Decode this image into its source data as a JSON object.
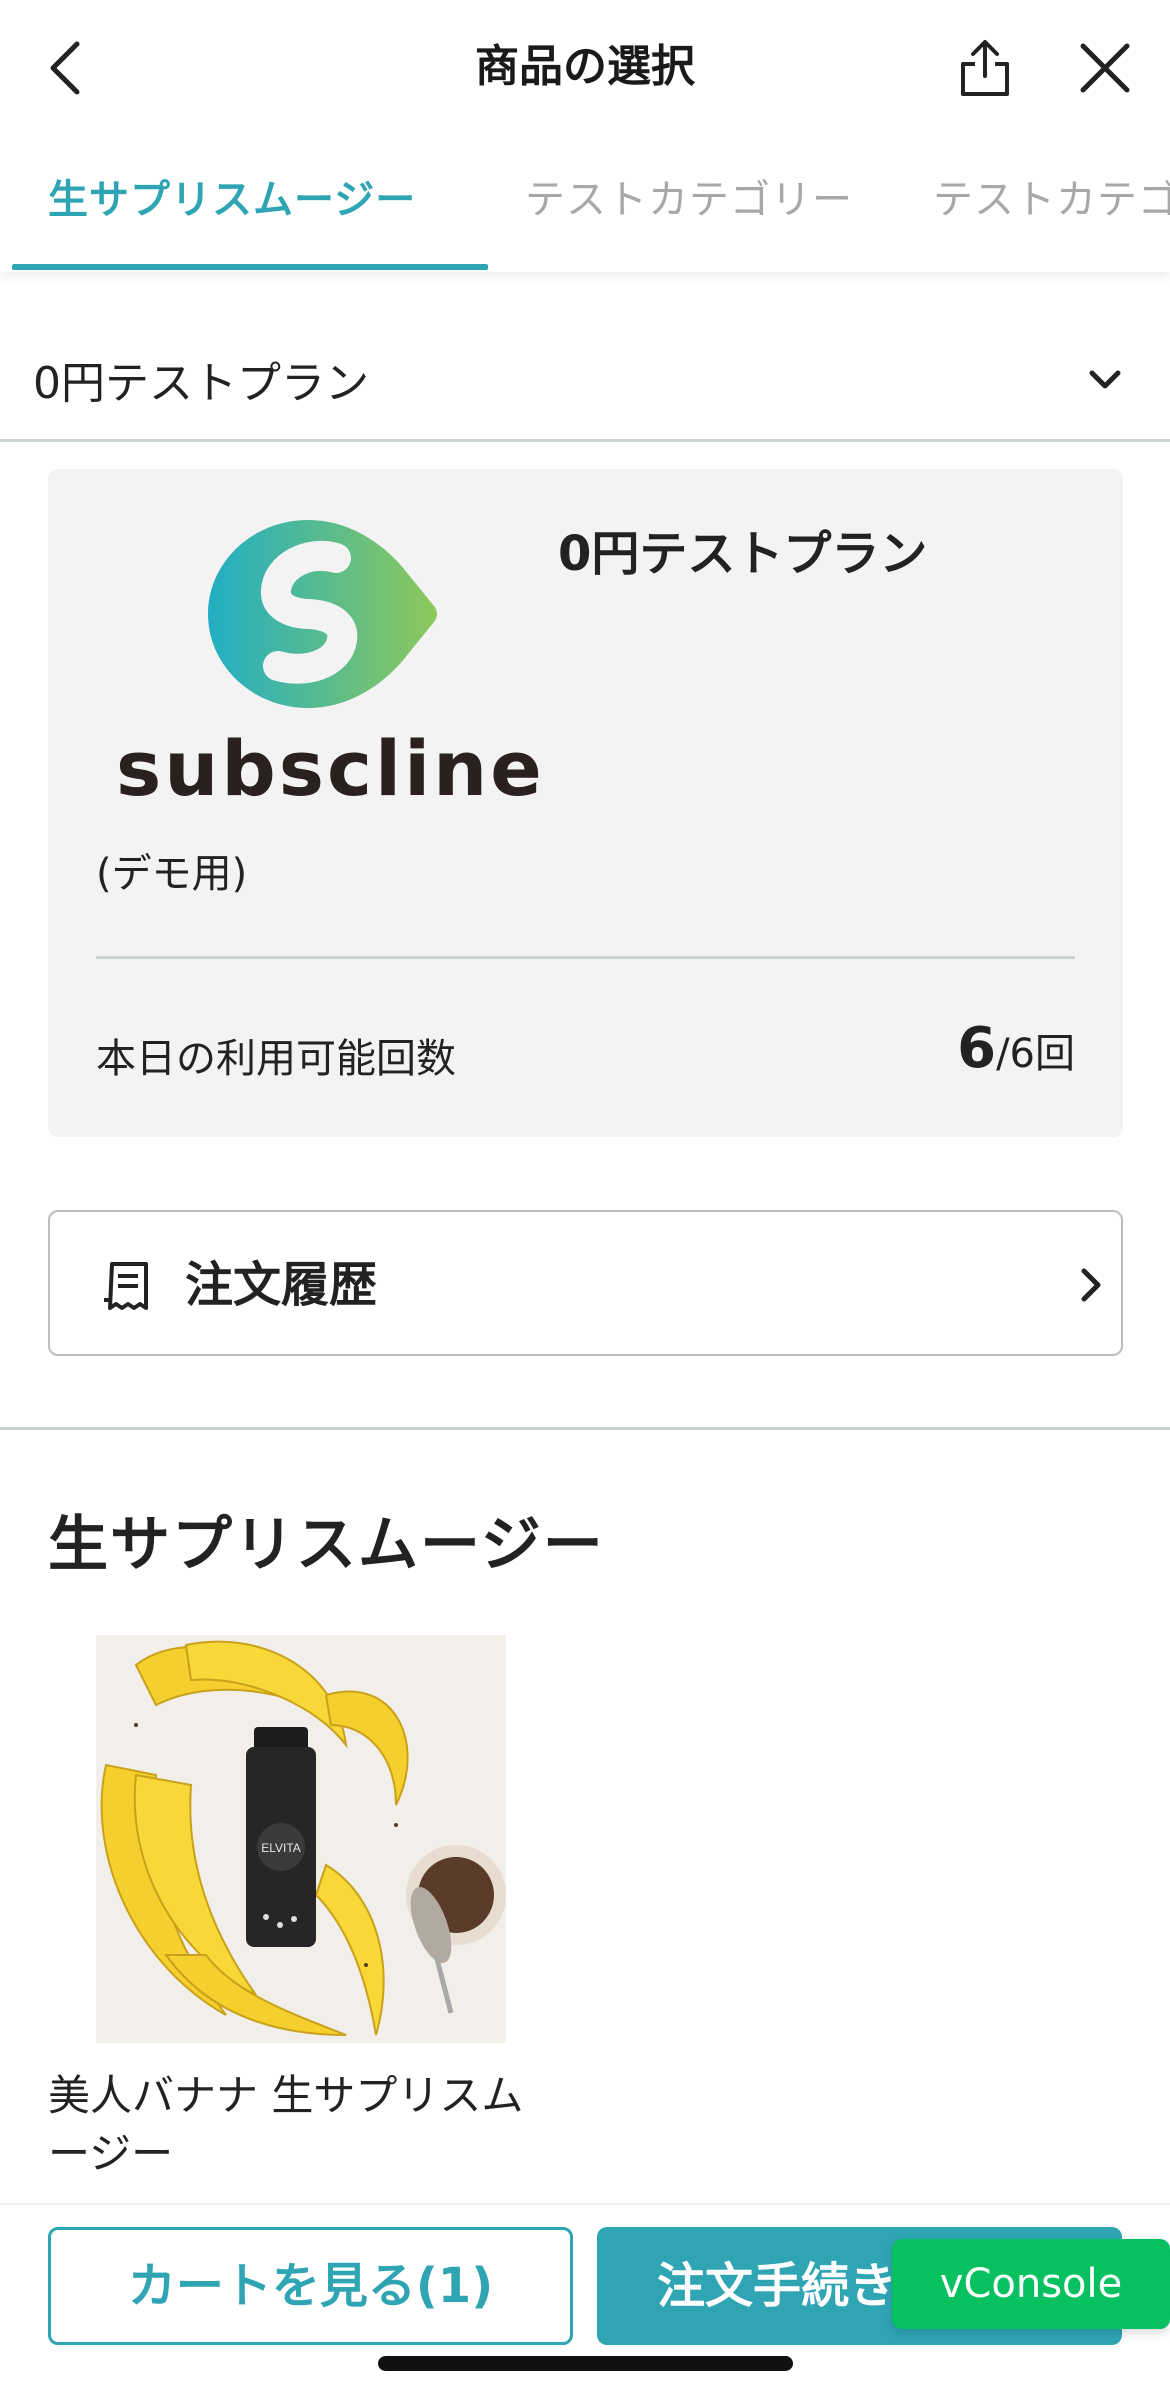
{
  "header": {
    "title": "商品の選択",
    "back_icon": "chevron-left-icon",
    "share_icon": "share-icon",
    "close_icon": "close-icon"
  },
  "tabs": [
    {
      "label": "生サプリスムージー",
      "active": true
    },
    {
      "label": "テストカテゴリー",
      "active": false
    },
    {
      "label": "テストカテゴリー",
      "active": false
    }
  ],
  "plan_selector": {
    "selected": "0円テストプラン",
    "icon": "chevron-down-icon"
  },
  "plan_card": {
    "logo_text": "subscline",
    "logo_sub": "(デモ用)",
    "plan_name": "0円テストプラン",
    "usage_label": "本日の利用可能回数",
    "usage_remaining": "6",
    "usage_total": "/6回"
  },
  "order_history": {
    "label": "注文履歴",
    "icon": "receipt-icon",
    "arrow_icon": "chevron-right-icon"
  },
  "section": {
    "title": "生サプリスムージー"
  },
  "products": [
    {
      "name": "美人バナナ 生サプリスムージー",
      "bottle_label": "ELVITA"
    }
  ],
  "bottom_bar": {
    "cart_label": "カートを見る(1)",
    "checkout_label": "注文手続き",
    "vconsole_label": "vConsole"
  },
  "colors": {
    "accent": "#2fa5b4",
    "card_bg": "#f3f3f3",
    "vconsole": "#07c160"
  }
}
